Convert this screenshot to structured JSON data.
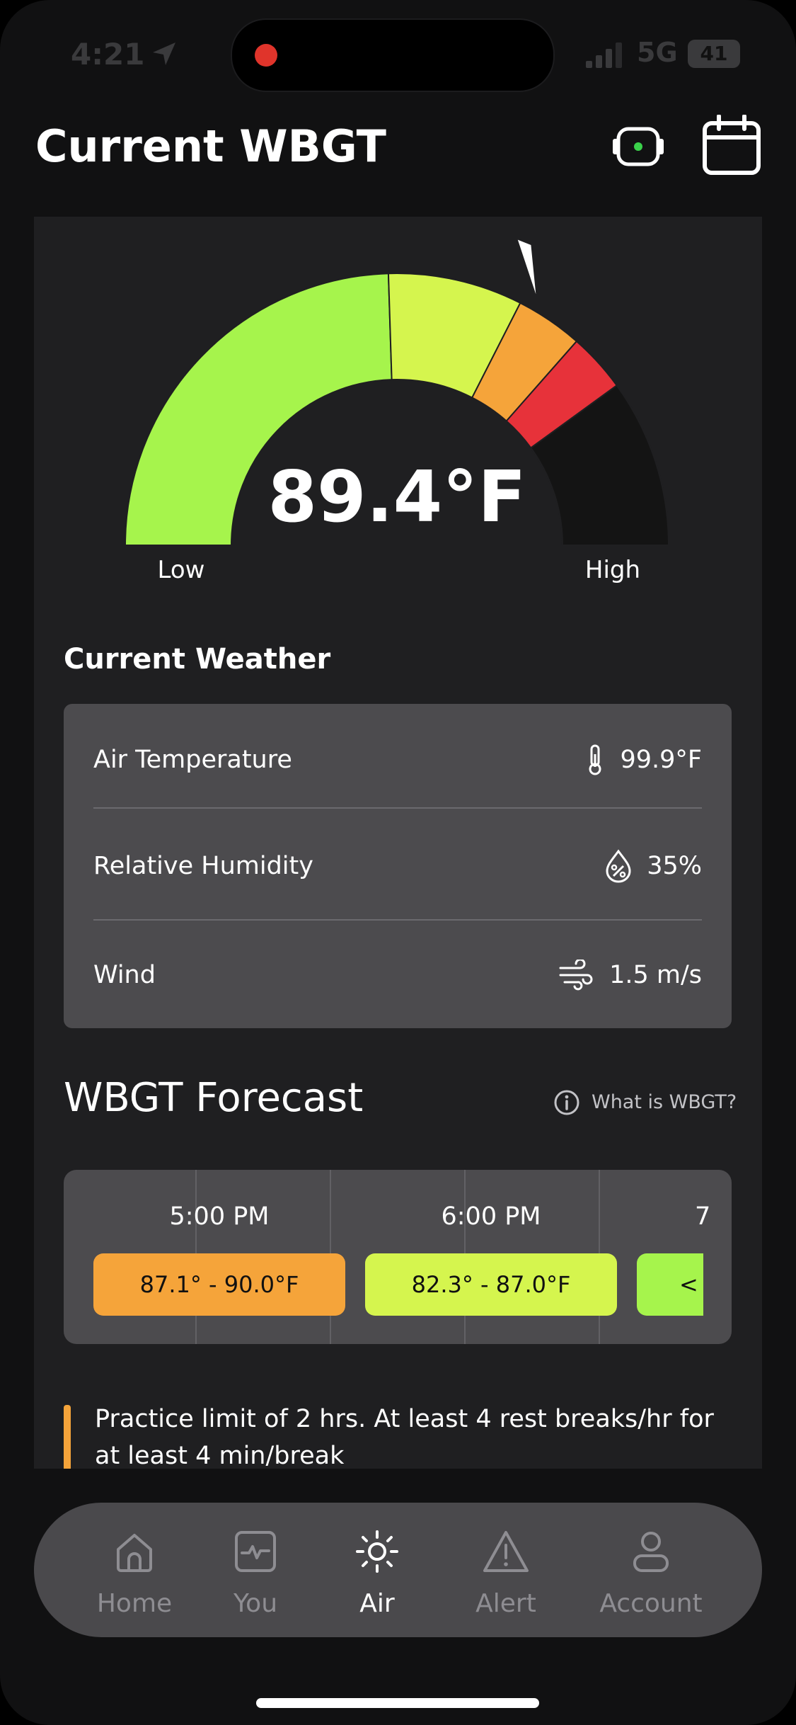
{
  "status_bar": {
    "time": "4:21",
    "network": "5G",
    "battery": "41"
  },
  "header": {
    "title": "Current WBGT"
  },
  "gauge": {
    "value_text": "89.4°F",
    "low_label": "Low",
    "high_label": "High",
    "level": 0.62,
    "colors": [
      "#a6f44c",
      "#d5f54e",
      "#f5a43a",
      "#e7323a",
      "#141414"
    ]
  },
  "current_weather": {
    "title": "Current Weather",
    "rows": [
      {
        "label": "Air Temperature",
        "value": "99.9°F",
        "icon": "thermometer-icon"
      },
      {
        "label": "Relative Humidity",
        "value": "35%",
        "icon": "humidity-drop-icon"
      },
      {
        "label": "Wind",
        "value": "1.5 m/s",
        "icon": "wind-icon"
      }
    ]
  },
  "forecast": {
    "title": "WBGT Forecast",
    "info_link": "What is WBGT?",
    "items": [
      {
        "time": "5:00 PM",
        "range": "87.1° - 90.0°F",
        "color": "#f5a43a"
      },
      {
        "time": "6:00 PM",
        "range": "82.3° - 87.0°F",
        "color": "#d5f54e"
      },
      {
        "time": "7",
        "range": "<",
        "color": "#a6f44c"
      }
    ]
  },
  "guidance": {
    "text": "Practice limit of 2 hrs. At least 4 rest breaks/hr for at least 4 min/break",
    "accent": "#f5a43a"
  },
  "tabbar": {
    "tabs": [
      {
        "label": "Home",
        "icon": "home-icon"
      },
      {
        "label": "You",
        "icon": "activity-icon"
      },
      {
        "label": "Air",
        "icon": "sun-icon",
        "active": true
      },
      {
        "label": "Alert",
        "icon": "alert-triangle-icon"
      },
      {
        "label": "Account",
        "icon": "user-icon"
      }
    ]
  }
}
